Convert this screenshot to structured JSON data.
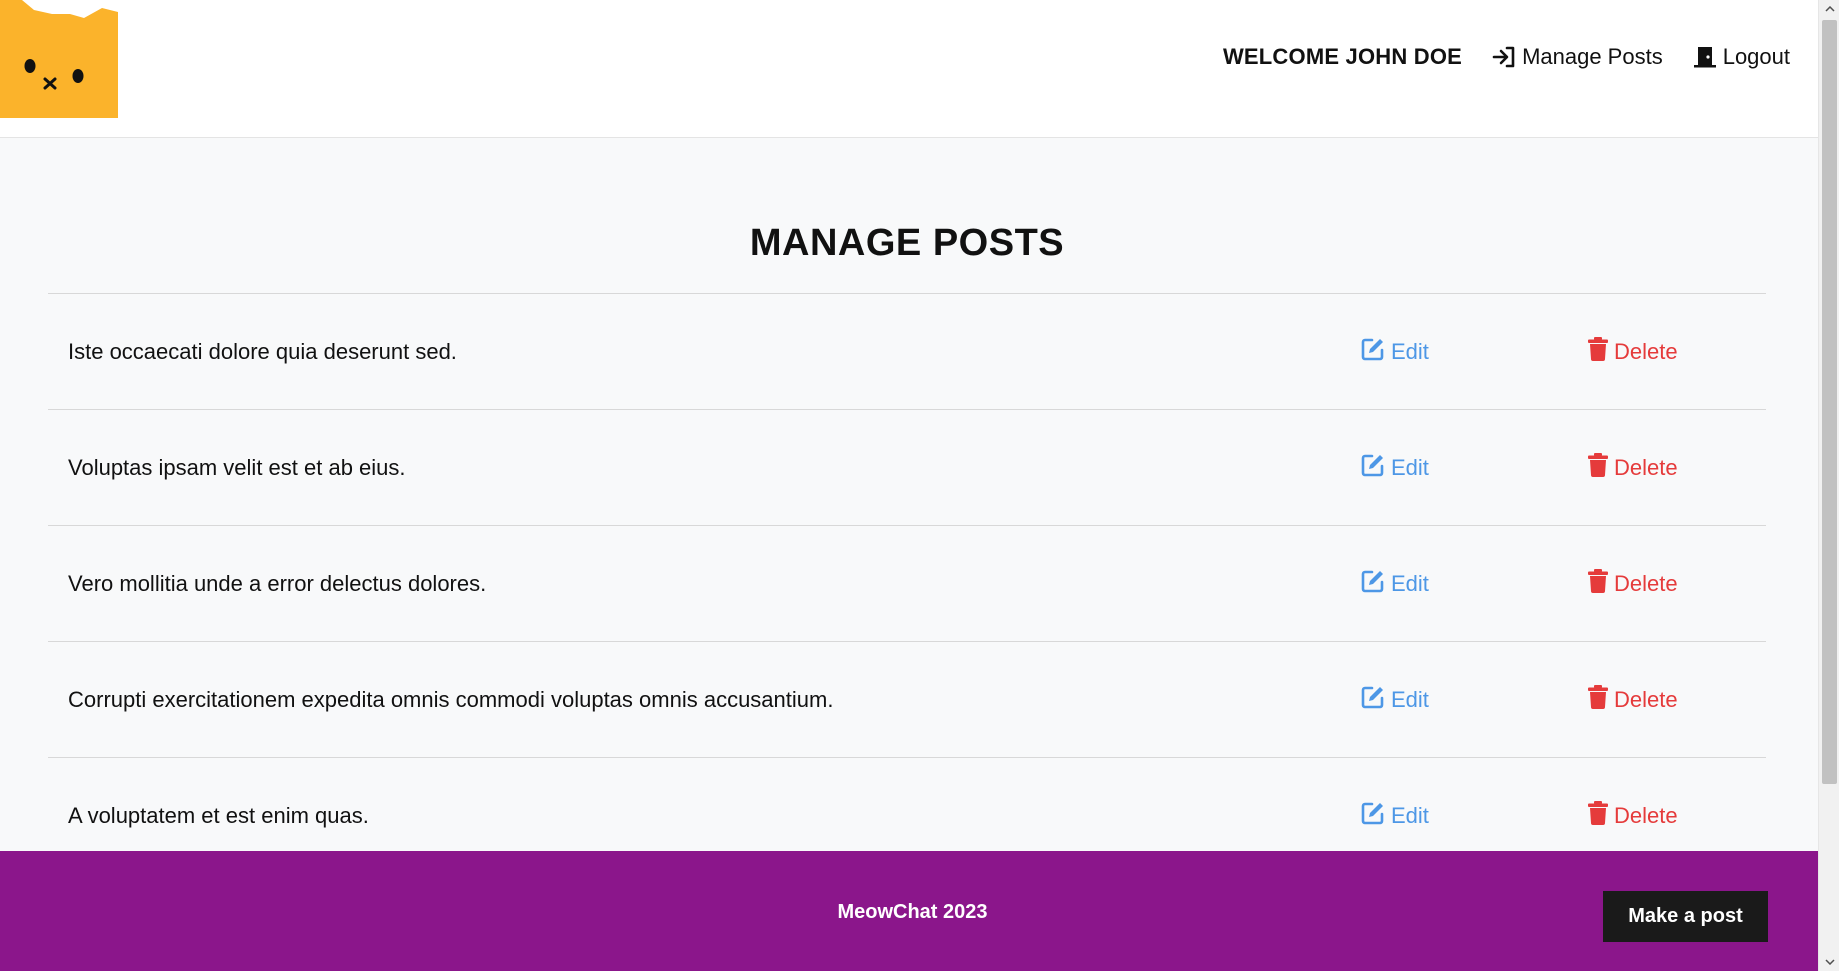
{
  "header": {
    "welcome": "WELCOME JOHN DOE",
    "nav": {
      "manage_posts": "Manage Posts",
      "logout": "Logout"
    }
  },
  "main": {
    "title": "MANAGE POSTS",
    "posts": [
      {
        "text": "Iste occaecati dolore quia deserunt sed.",
        "edit": "Edit",
        "delete": "Delete"
      },
      {
        "text": "Voluptas ipsam velit est et ab eius.",
        "edit": "Edit",
        "delete": "Delete"
      },
      {
        "text": "Vero mollitia unde a error delectus dolores.",
        "edit": "Edit",
        "delete": "Delete"
      },
      {
        "text": "Corrupti exercitationem expedita omnis commodi voluptas omnis accusantium.",
        "edit": "Edit",
        "delete": "Delete"
      },
      {
        "text": "A voluptatem et est enim quas.",
        "edit": "Edit",
        "delete": "Delete"
      }
    ]
  },
  "footer": {
    "text": "MeowChat 2023",
    "make_post": "Make a post"
  },
  "icons": {
    "logo": "cat-face-logo",
    "manage": "sign-in-arrow-icon",
    "logout": "door-icon",
    "edit": "edit-square-pen-icon",
    "delete": "trash-icon"
  },
  "colors": {
    "brand_orange": "#fbb32b",
    "footer_purple": "#8b168b",
    "edit_blue": "#4d97e6",
    "delete_red": "#e53b3b",
    "button_dark": "#1a1a1a"
  }
}
